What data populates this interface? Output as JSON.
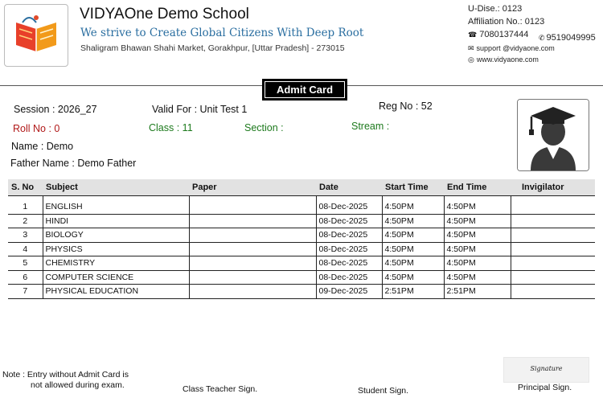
{
  "school": {
    "name": "VIDYAOne Demo School",
    "tagline": "We strive to Create Global Citizens With Deep Root",
    "address": "Shaligram Bhawan Shahi Market, Gorakhpur, [Uttar Pradesh] - 273015"
  },
  "contact": {
    "udise": "U-Dise.: 0123",
    "affiliation": "Affiliation No.: 0123",
    "phone1": "7080137444",
    "phone2": "9519049995",
    "email": "support @vidyaone.com",
    "website": "www.vidyaone.com"
  },
  "card": {
    "title": "Admit Card"
  },
  "student": {
    "session": "Session : 2026_27",
    "valid_for": "Valid For : Unit Test 1",
    "reg_no": "Reg No : 52",
    "roll_no": "Roll No : 0",
    "class": "Class : 11",
    "section": "Section :",
    "stream": "Stream :",
    "name": "Name : Demo",
    "father_name": "Father Name : Demo Father"
  },
  "table": {
    "headers": [
      "S. No",
      "Subject",
      "Paper",
      "Date",
      "Start Time",
      "End Time",
      "Invigilator"
    ],
    "rows": [
      [
        "1",
        "ENGLISH",
        "",
        "08-Dec-2025",
        "4:50PM",
        "4:50PM",
        ""
      ],
      [
        "2",
        "HINDI",
        "",
        "08-Dec-2025",
        "4:50PM",
        "4:50PM",
        ""
      ],
      [
        "3",
        "BIOLOGY",
        "",
        "08-Dec-2025",
        "4:50PM",
        "4:50PM",
        ""
      ],
      [
        "4",
        "PHYSICS",
        "",
        "08-Dec-2025",
        "4:50PM",
        "4:50PM",
        ""
      ],
      [
        "5",
        "CHEMISTRY",
        "",
        "08-Dec-2025",
        "4:50PM",
        "4:50PM",
        ""
      ],
      [
        "6",
        "COMPUTER SCIENCE",
        "",
        "08-Dec-2025",
        "4:50PM",
        "4:50PM",
        ""
      ],
      [
        "7",
        "PHYSICAL EDUCATION",
        "",
        "09-Dec-2025",
        "2:51PM",
        "2:51PM",
        ""
      ]
    ]
  },
  "footer": {
    "note_line1": "Note : Entry without Admit Card is",
    "note_line2": "not allowed during exam.",
    "class_teacher_sign": "Class Teacher Sign.",
    "student_sign": "Student Sign.",
    "principal_sign": "Principal Sign.",
    "signature_text": "Signature"
  },
  "colors": {
    "red_label": "#b01818",
    "green_label": "#1d7a1d",
    "tagline": "#2a6ea0"
  },
  "icons": [
    "book-logo-icon",
    "phone-icon",
    "mobile-icon",
    "email-icon",
    "website-icon",
    "student-avatar-icon"
  ]
}
